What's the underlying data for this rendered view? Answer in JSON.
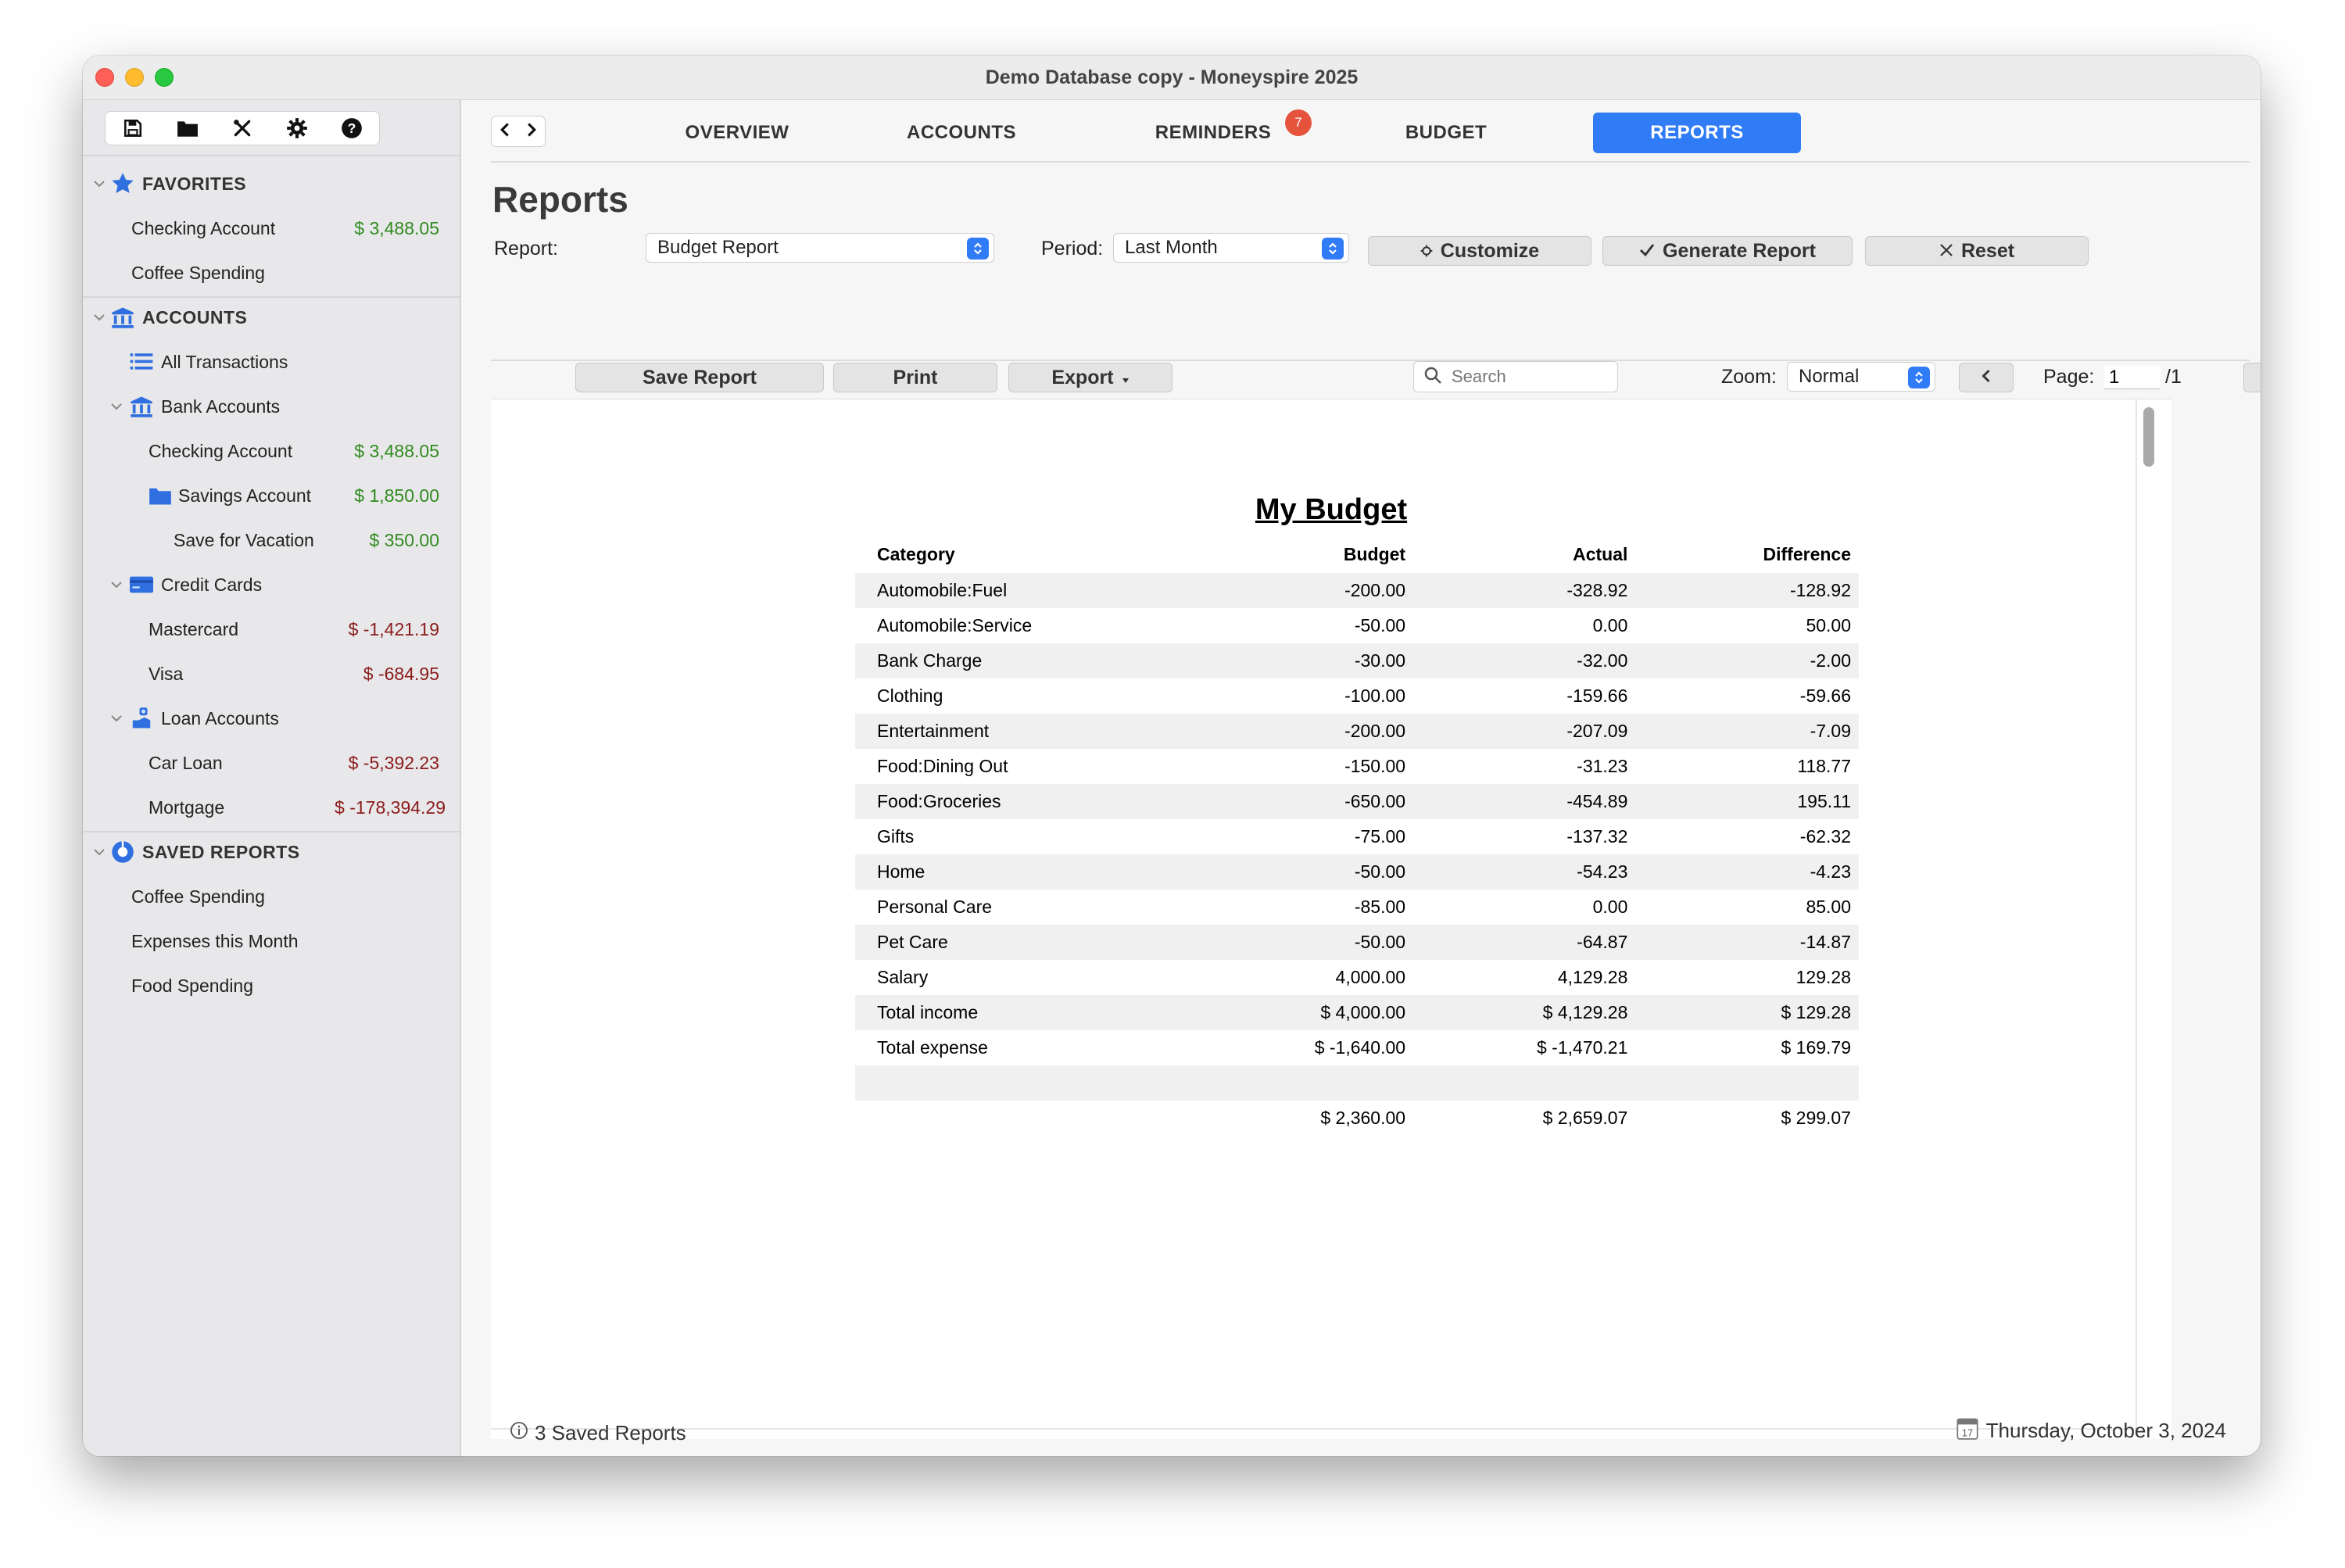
{
  "window": {
    "title": "Demo Database copy - Moneyspire 2025"
  },
  "sidebar": {
    "toolbar_icons": [
      "save-icon",
      "folder-icon",
      "tools-icon",
      "gear-icon",
      "help-icon"
    ],
    "favorites": {
      "header": "FAVORITES",
      "items": [
        {
          "label": "Checking Account",
          "amount": "$ 3,488.05"
        },
        {
          "label": "Coffee Spending"
        }
      ]
    },
    "accounts": {
      "header": "ACCOUNTS",
      "all_transactions": "All Transactions",
      "bank_accounts": "Bank Accounts",
      "checking": {
        "label": "Checking Account",
        "amount": "$ 3,488.05"
      },
      "savings": {
        "label": "Savings Account",
        "amount": "$ 1,850.00"
      },
      "vacation": {
        "label": "Save for Vacation",
        "amount": "$ 350.00"
      },
      "credit_cards": "Credit Cards",
      "mastercard": {
        "label": "Mastercard",
        "amount": "$ -1,421.19"
      },
      "visa": {
        "label": "Visa",
        "amount": "$ -684.95"
      },
      "loan_accounts": "Loan Accounts",
      "car_loan": {
        "label": "Car Loan",
        "amount": "$ -5,392.23"
      },
      "mortgage": {
        "label": "Mortgage",
        "amount": "$ -178,394.29"
      }
    },
    "saved_reports": {
      "header": "SAVED REPORTS",
      "items": [
        "Coffee Spending",
        "Expenses this Month",
        "Food Spending"
      ]
    }
  },
  "tabs": {
    "overview": "OVERVIEW",
    "accounts": "ACCOUNTS",
    "reminders": "REMINDERS",
    "reminders_badge": "7",
    "budget": "BUDGET",
    "reports": "REPORTS"
  },
  "reports": {
    "title": "Reports",
    "report_label": "Report:",
    "report_value": "Budget Report",
    "period_label": "Period:",
    "period_value": "Last Month",
    "customize": "Customize",
    "generate": "Generate Report",
    "reset": "Reset",
    "save_report": "Save Report",
    "print": "Print",
    "export": "Export",
    "search_placeholder": "Search",
    "zoom_label": "Zoom:",
    "zoom_value": "Normal",
    "page_label": "Page:",
    "page_value": "1",
    "page_total": "/1"
  },
  "report": {
    "title": "My Budget",
    "columns": [
      "Category",
      "Budget",
      "Actual",
      "Difference"
    ],
    "rows": [
      {
        "category": "Automobile:Fuel",
        "budget": "-200.00",
        "actual": "-328.92",
        "difference": "-128.92",
        "bs": "neg",
        "as": "neg",
        "ds": "neg"
      },
      {
        "category": "Automobile:Service",
        "budget": "-50.00",
        "actual": "0.00",
        "difference": "50.00",
        "bs": "neg",
        "as": "pos",
        "ds": "pos"
      },
      {
        "category": "Bank Charge",
        "budget": "-30.00",
        "actual": "-32.00",
        "difference": "-2.00",
        "bs": "neg",
        "as": "neg",
        "ds": "neg"
      },
      {
        "category": "Clothing",
        "budget": "-100.00",
        "actual": "-159.66",
        "difference": "-59.66",
        "bs": "neg",
        "as": "neg",
        "ds": "neg"
      },
      {
        "category": "Entertainment",
        "budget": "-200.00",
        "actual": "-207.09",
        "difference": "-7.09",
        "bs": "neg",
        "as": "neg",
        "ds": "neg"
      },
      {
        "category": "Food:Dining Out",
        "budget": "-150.00",
        "actual": "-31.23",
        "difference": "118.77",
        "bs": "neg",
        "as": "neg",
        "ds": "pos"
      },
      {
        "category": "Food:Groceries",
        "budget": "-650.00",
        "actual": "-454.89",
        "difference": "195.11",
        "bs": "neg",
        "as": "neg",
        "ds": "pos"
      },
      {
        "category": "Gifts",
        "budget": "-75.00",
        "actual": "-137.32",
        "difference": "-62.32",
        "bs": "neg",
        "as": "neg",
        "ds": "neg"
      },
      {
        "category": "Home",
        "budget": "-50.00",
        "actual": "-54.23",
        "difference": "-4.23",
        "bs": "neg",
        "as": "neg",
        "ds": "neg"
      },
      {
        "category": "Personal Care",
        "budget": "-85.00",
        "actual": "0.00",
        "difference": "85.00",
        "bs": "neg",
        "as": "pos",
        "ds": "pos"
      },
      {
        "category": "Pet Care",
        "budget": "-50.00",
        "actual": "-64.87",
        "difference": "-14.87",
        "bs": "neg",
        "as": "neg",
        "ds": "neg"
      },
      {
        "category": "Salary",
        "budget": "4,000.00",
        "actual": "4,129.28",
        "difference": "129.28",
        "bs": "pos",
        "as": "pos",
        "ds": "pos"
      },
      {
        "category": "Total income",
        "budget": "$ 4,000.00",
        "actual": "$ 4,129.28",
        "difference": "$ 129.28",
        "bs": "pos",
        "as": "pos",
        "ds": "pos"
      },
      {
        "category": "Total expense",
        "budget": "$ -1,640.00",
        "actual": "$ -1,470.21",
        "difference": "$ 169.79",
        "bs": "neg",
        "as": "neg",
        "ds": "pos"
      },
      {
        "category": "",
        "budget": "",
        "actual": "",
        "difference": "",
        "bs": "pos",
        "as": "pos",
        "ds": "pos"
      },
      {
        "category": "",
        "budget": "$ 2,360.00",
        "actual": "$ 2,659.07",
        "difference": "$ 299.07",
        "bs": "pos",
        "as": "pos",
        "ds": "pos"
      }
    ]
  },
  "status": {
    "left": "3 Saved Reports",
    "right": "Thursday, October 3, 2024"
  },
  "colors": {
    "accent": "#2f7cf6",
    "positive": "#2f8a1e",
    "negative": "#8b1a1a",
    "badge": "#e5533d"
  }
}
